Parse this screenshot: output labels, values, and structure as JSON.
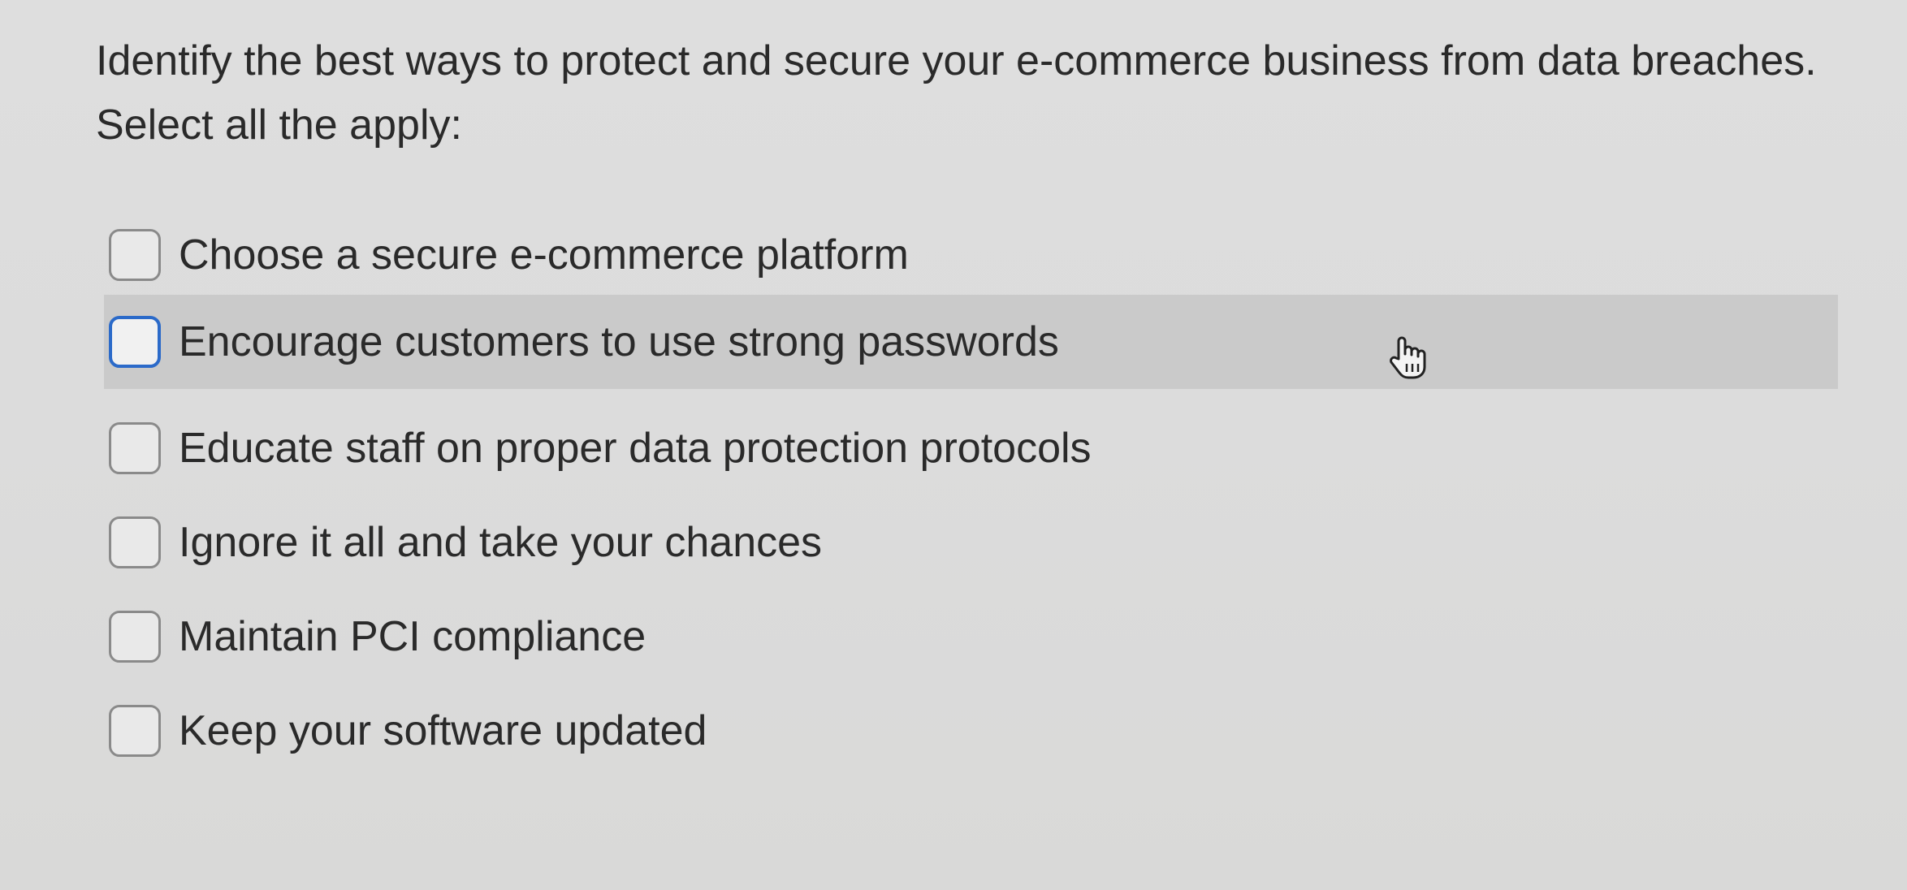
{
  "question": {
    "text": "Identify the best ways to protect and secure your e-commerce business from data breaches. Select all the apply:"
  },
  "options": [
    {
      "label": "Choose a secure e-commerce platform",
      "checked": false
    },
    {
      "label": "Encourage customers to use strong passwords",
      "checked": false,
      "hovered": true,
      "focused": true
    },
    {
      "label": "Educate staff on proper data protection protocols",
      "checked": false
    },
    {
      "label": "Ignore it all and take your chances",
      "checked": false
    },
    {
      "label": "Maintain PCI compliance",
      "checked": false
    },
    {
      "label": "Keep your software updated",
      "checked": false
    }
  ],
  "colors": {
    "focus_border": "#2b6ac9",
    "hover_background": "#cacaca",
    "text": "#2a2a2a"
  },
  "icons": {
    "cursor": "hand-pointer-icon"
  }
}
